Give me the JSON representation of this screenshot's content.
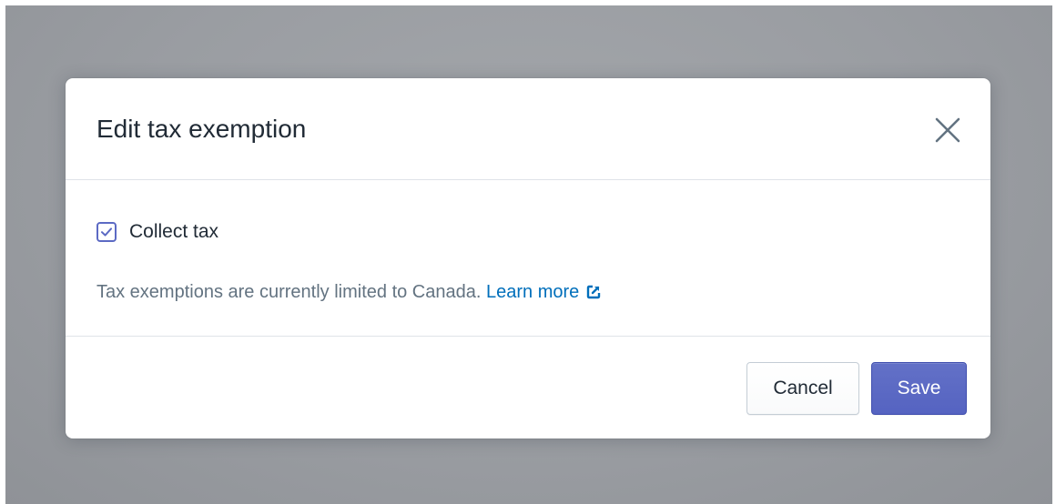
{
  "modal": {
    "title": "Edit tax exemption",
    "close_icon": "close-icon"
  },
  "body": {
    "checkbox": {
      "label": "Collect tax",
      "checked": true,
      "check_icon": "checkmark-icon"
    },
    "info_text": "Tax exemptions are currently limited to Canada.",
    "link_text": "Learn more",
    "link_icon": "external-link-icon"
  },
  "footer": {
    "cancel_label": "Cancel",
    "save_label": "Save"
  },
  "colors": {
    "accent": "#5c6ac4",
    "link": "#006fbb",
    "text_primary": "#212b36",
    "text_secondary": "#637381",
    "backdrop": "#9b9ea3"
  }
}
